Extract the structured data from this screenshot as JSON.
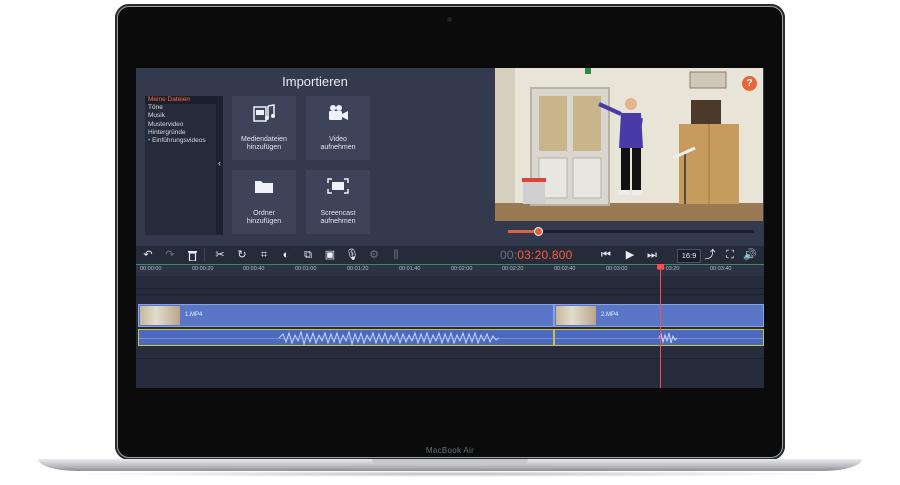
{
  "device": {
    "label": "MacBook Air"
  },
  "import_panel": {
    "title": "Importieren",
    "sources": [
      {
        "label": "Meine Dateien",
        "active": true
      },
      {
        "label": "Töne"
      },
      {
        "label": "Musik"
      },
      {
        "label": "Mustervideo"
      },
      {
        "label": "Hintergründe"
      },
      {
        "label": "Einführungsvideos",
        "dotted": true
      }
    ],
    "tiles": [
      {
        "label": "Mediendateien\nhinzufügen",
        "icon": "media-files-icon"
      },
      {
        "label": "Video\naufnehmen",
        "icon": "video-camera-icon"
      },
      {
        "label": "Ordner\nhinzufügen",
        "icon": "folder-icon"
      },
      {
        "label": "Screencast\naufnehmen",
        "icon": "screencast-icon"
      }
    ]
  },
  "preview": {
    "help_label": "?",
    "progress": 0.12
  },
  "toolbar": {
    "timecode_dim": "00:",
    "timecode_active": "03:20.800",
    "aspect_label": "16:9"
  },
  "ruler": {
    "labels": [
      "00:00:00",
      "00:00:20",
      "00:00:40",
      "00:01:00",
      "00:01:20",
      "00:01:40",
      "00:02:00",
      "00:02:20",
      "00:02:40",
      "00:03:00",
      "00:03:20",
      "00:03:40"
    ]
  },
  "timeline": {
    "clips": [
      {
        "name": "1.MP4"
      },
      {
        "name": "2.MP4"
      }
    ]
  },
  "colors": {
    "accent": "#ff5b3a",
    "clip": "#5a76c7",
    "panel": "#343a4d"
  }
}
